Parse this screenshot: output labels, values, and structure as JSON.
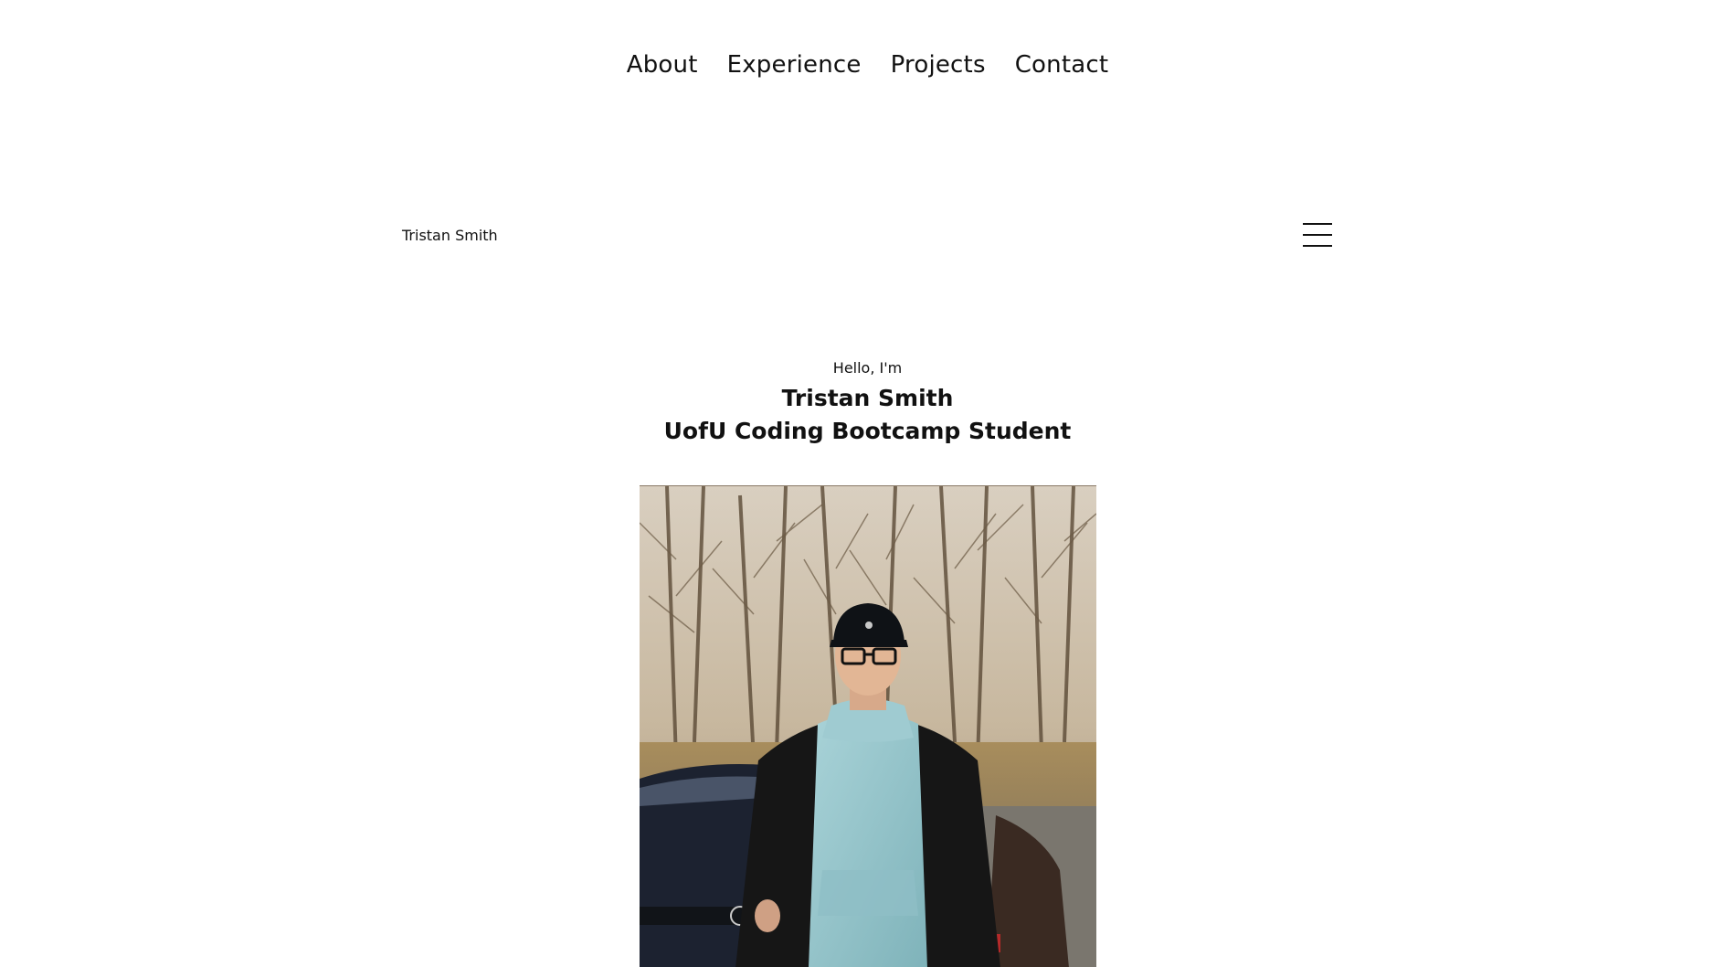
{
  "nav": {
    "items": [
      {
        "label": "About"
      },
      {
        "label": "Experience"
      },
      {
        "label": "Projects"
      },
      {
        "label": "Contact"
      }
    ]
  },
  "header": {
    "brand": "Tristan Smith",
    "menu_icon": "hamburger-icon"
  },
  "hero": {
    "greeting": "Hello, I'm",
    "name": "Tristan Smith",
    "role": "UofU Coding Bootcamp Student"
  },
  "photo": {
    "subject": "profile-photo"
  },
  "colors": {
    "text": "#111111",
    "background": "#ffffff"
  }
}
